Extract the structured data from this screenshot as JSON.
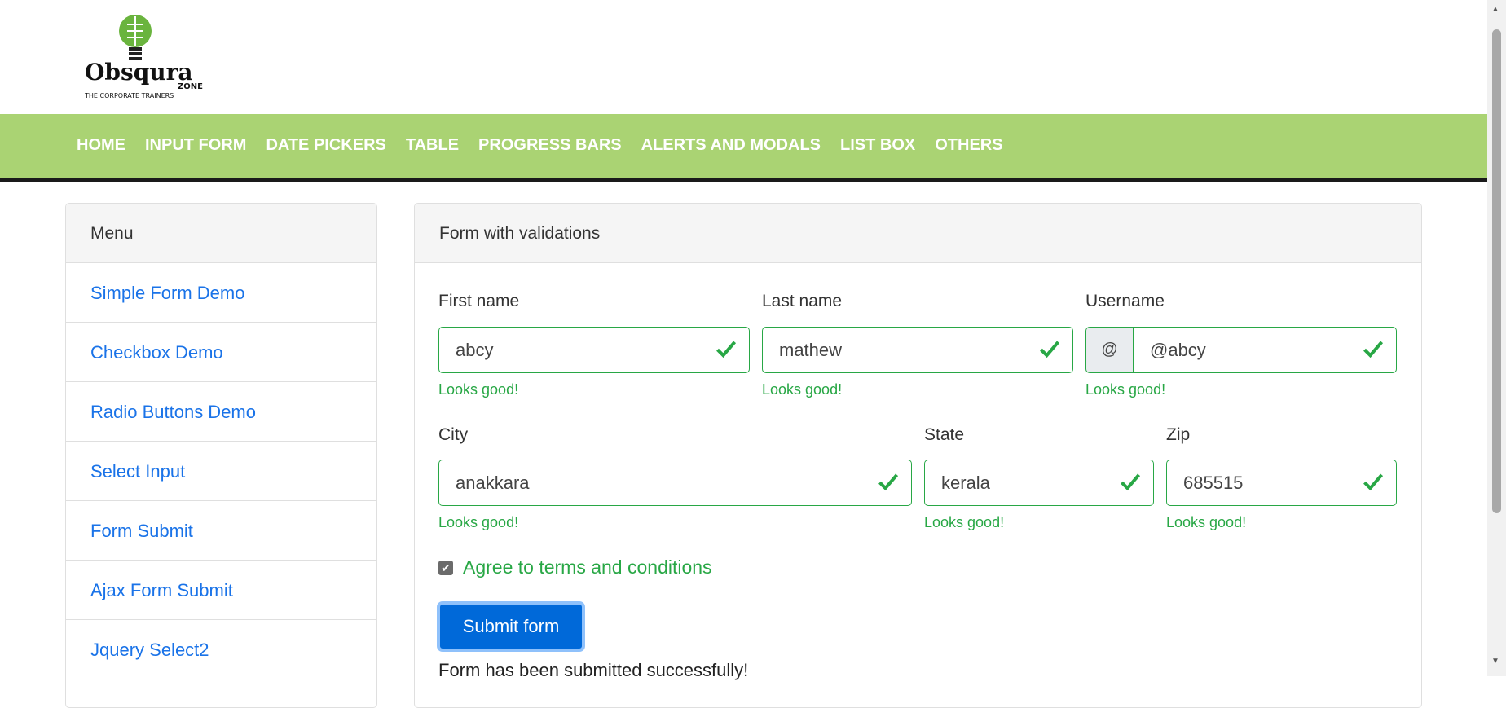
{
  "logo": {
    "name": "Obsqura",
    "sub": "ZONE",
    "tagline": "THE CORPORATE TRAINERS"
  },
  "nav": [
    "HOME",
    "INPUT FORM",
    "DATE PICKERS",
    "TABLE",
    "PROGRESS BARS",
    "ALERTS AND MODALS",
    "LIST BOX",
    "OTHERS"
  ],
  "sidebar": {
    "title": "Menu",
    "items": [
      "Simple Form Demo",
      "Checkbox Demo",
      "Radio Buttons Demo",
      "Select Input",
      "Form Submit",
      "Ajax Form Submit",
      "Jquery Select2"
    ]
  },
  "form": {
    "title": "Form with validations",
    "first_name": {
      "label": "First name",
      "value": "abcy",
      "feedback": "Looks good!"
    },
    "last_name": {
      "label": "Last name",
      "value": "mathew",
      "feedback": "Looks good!"
    },
    "username": {
      "label": "Username",
      "prefix": "@",
      "value": "@abcy",
      "feedback": "Looks good!"
    },
    "city": {
      "label": "City",
      "value": "anakkara",
      "feedback": "Looks good!"
    },
    "state": {
      "label": "State",
      "value": "kerala",
      "feedback": "Looks good!"
    },
    "zip": {
      "label": "Zip",
      "value": "685515",
      "feedback": "Looks good!"
    },
    "agree": {
      "label": "Agree to terms and conditions",
      "checked": true
    },
    "submit_label": "Submit form",
    "message": "Form has been submitted successfully!"
  },
  "colors": {
    "nav": "#aad373",
    "valid": "#28a745",
    "primary": "#0069d9",
    "link": "#1a73e8"
  }
}
